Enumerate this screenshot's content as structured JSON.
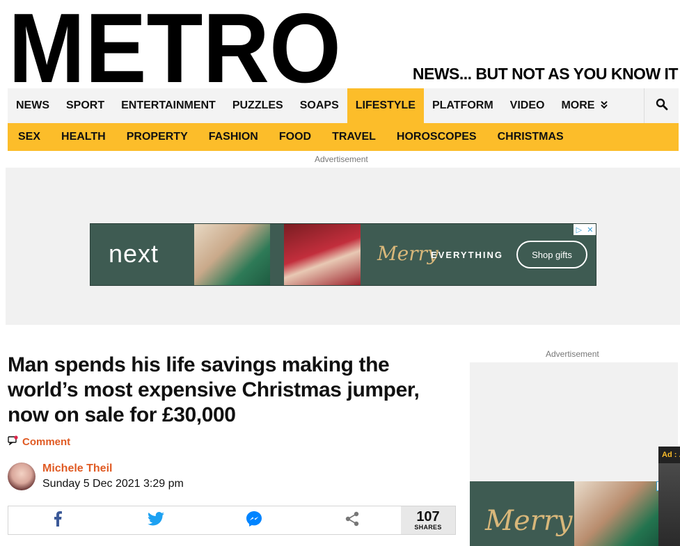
{
  "site": {
    "logo_text": "METRO",
    "tagline": "NEWS... BUT NOT AS YOU KNOW IT"
  },
  "nav": {
    "items": [
      {
        "label": "NEWS"
      },
      {
        "label": "SPORT"
      },
      {
        "label": "ENTERTAINMENT"
      },
      {
        "label": "PUZZLES"
      },
      {
        "label": "SOAPS"
      },
      {
        "label": "LIFESTYLE",
        "active": true
      },
      {
        "label": "PLATFORM"
      },
      {
        "label": "VIDEO"
      },
      {
        "label": "MORE"
      }
    ],
    "more_icon": "double-chevron-down-icon",
    "search_icon": "search-icon"
  },
  "subnav": {
    "items": [
      {
        "label": "SEX"
      },
      {
        "label": "HEALTH"
      },
      {
        "label": "PROPERTY"
      },
      {
        "label": "FASHION"
      },
      {
        "label": "FOOD"
      },
      {
        "label": "TRAVEL"
      },
      {
        "label": "HOROSCOPES"
      },
      {
        "label": "CHRISTMAS"
      }
    ]
  },
  "ads": {
    "label": "Advertisement",
    "banner": {
      "brand": "next",
      "script": "Merry",
      "word": "EVERYTHING",
      "cta": "Shop gifts"
    },
    "side_script": "Merry",
    "corner_tab": "Ad : ..."
  },
  "article": {
    "headline": "Man spends his life savings making the world’s most expensive Christmas jumper, now on sale for £30,000",
    "comment_label": "Comment",
    "author": "Michele Theil",
    "date": "Sunday 5 Dec 2021 3:29 pm",
    "share_count": "107",
    "share_label": "SHARES"
  },
  "colors": {
    "accent_yellow": "#fcbd2a",
    "author_orange": "#e05b24",
    "ad_green": "#3e5b52",
    "facebook": "#3b5998",
    "twitter": "#1da1f2",
    "messenger": "#0084ff"
  }
}
